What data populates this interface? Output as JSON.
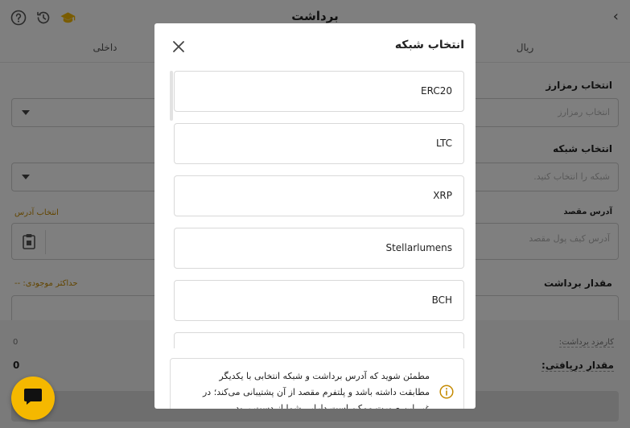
{
  "page": {
    "title": "برداشت",
    "tabs": [
      "داخلی",
      "ریال"
    ],
    "crypto_label": "انتخاب رمزارز",
    "crypto_placeholder": "انتخاب رمزارز",
    "network_label": "انتخاب شبکه",
    "network_placeholder": "شبکه را انتخاب کنید.",
    "address_label": "آدرس مقصد",
    "address_link": "انتخاب آدرس",
    "address_placeholder": "آدرس کیف پول مقصد",
    "amount_label": "مقدار برداشت",
    "max_balance_label": "حداکثر موجودی: --",
    "fee_label": "کارمزد برداشت:",
    "fee_value": "0",
    "receive_label": "مقدار دریافتی:",
    "receive_value": "0"
  },
  "modal": {
    "title": "انتخاب شبکه",
    "networks": [
      "ERC20",
      "LTC",
      "XRP",
      "Stellarlumens",
      "BCH"
    ],
    "warning": "مطمئن شوید که آدرس برداشت و شبکه انتخابی با یکدیگر مطابقت داشته باشد و پلتفرم مقصد از آن پشتیبانی می‌کند؛ در غیر این صورت ممکن است دارایی شما از دست برود."
  },
  "colors": {
    "accent": "#f5b800",
    "gold_link": "#c58a00",
    "overlay": "rgba(0,0,0,0.5)"
  },
  "icons": {
    "help": "help-circle-icon",
    "history": "history-icon",
    "academy": "graduation-cap-icon",
    "back": "chevron-right-icon",
    "close": "close-icon",
    "info": "info-icon",
    "chat": "chat-icon",
    "paste": "clipboard-icon"
  }
}
